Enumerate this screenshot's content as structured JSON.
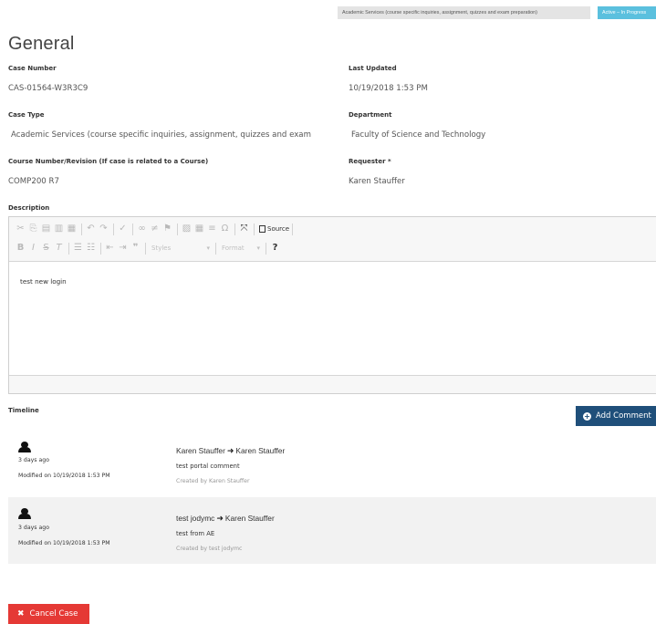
{
  "badges": {
    "category": "Academic Services (course specific inquiries, assignment, quizzes and exam preparation)",
    "status": "Active – In Progress"
  },
  "title": "General",
  "fields": {
    "case_number": {
      "label": "Case Number",
      "value": "CAS-01564-W3R3C9"
    },
    "last_updated": {
      "label": "Last Updated",
      "value": "10/19/2018 1:53 PM"
    },
    "case_type": {
      "label": "Case Type",
      "value": "Academic Services (course specific inquiries, assignment, quizzes and exam"
    },
    "department": {
      "label": "Department",
      "value": "Faculty of Science and Technology"
    },
    "course": {
      "label": "Course Number/Revision (If case is related to a Course)",
      "value": "COMP200 R7"
    },
    "requester": {
      "label": "Requester *",
      "value": "Karen Stauffer"
    }
  },
  "description": {
    "label": "Description",
    "content": "test new login",
    "toolbar": {
      "source_label": "Source",
      "styles_label": "Styles",
      "format_label": "Format"
    }
  },
  "timeline": {
    "label": "Timeline",
    "add_comment_label": "Add Comment",
    "items": [
      {
        "ago": "3 days ago",
        "modified": "Modified on 10/19/2018 1:53 PM",
        "from": "Karen Stauffer",
        "to": "Karen Stauffer",
        "text": "test portal comment",
        "created_by": "Created by Karen Stauffer"
      },
      {
        "ago": "3 days ago",
        "modified": "Modified on 10/19/2018 1:53 PM",
        "from": "test jodymc",
        "to": "Karen Stauffer",
        "text": "test from AE",
        "created_by": "Created by test jodymc"
      }
    ]
  },
  "cancel_label": "Cancel Case",
  "colors": {
    "primary_button": "#1f4f7a",
    "danger_button": "#e53935",
    "status_badge": "#5bc0de"
  }
}
